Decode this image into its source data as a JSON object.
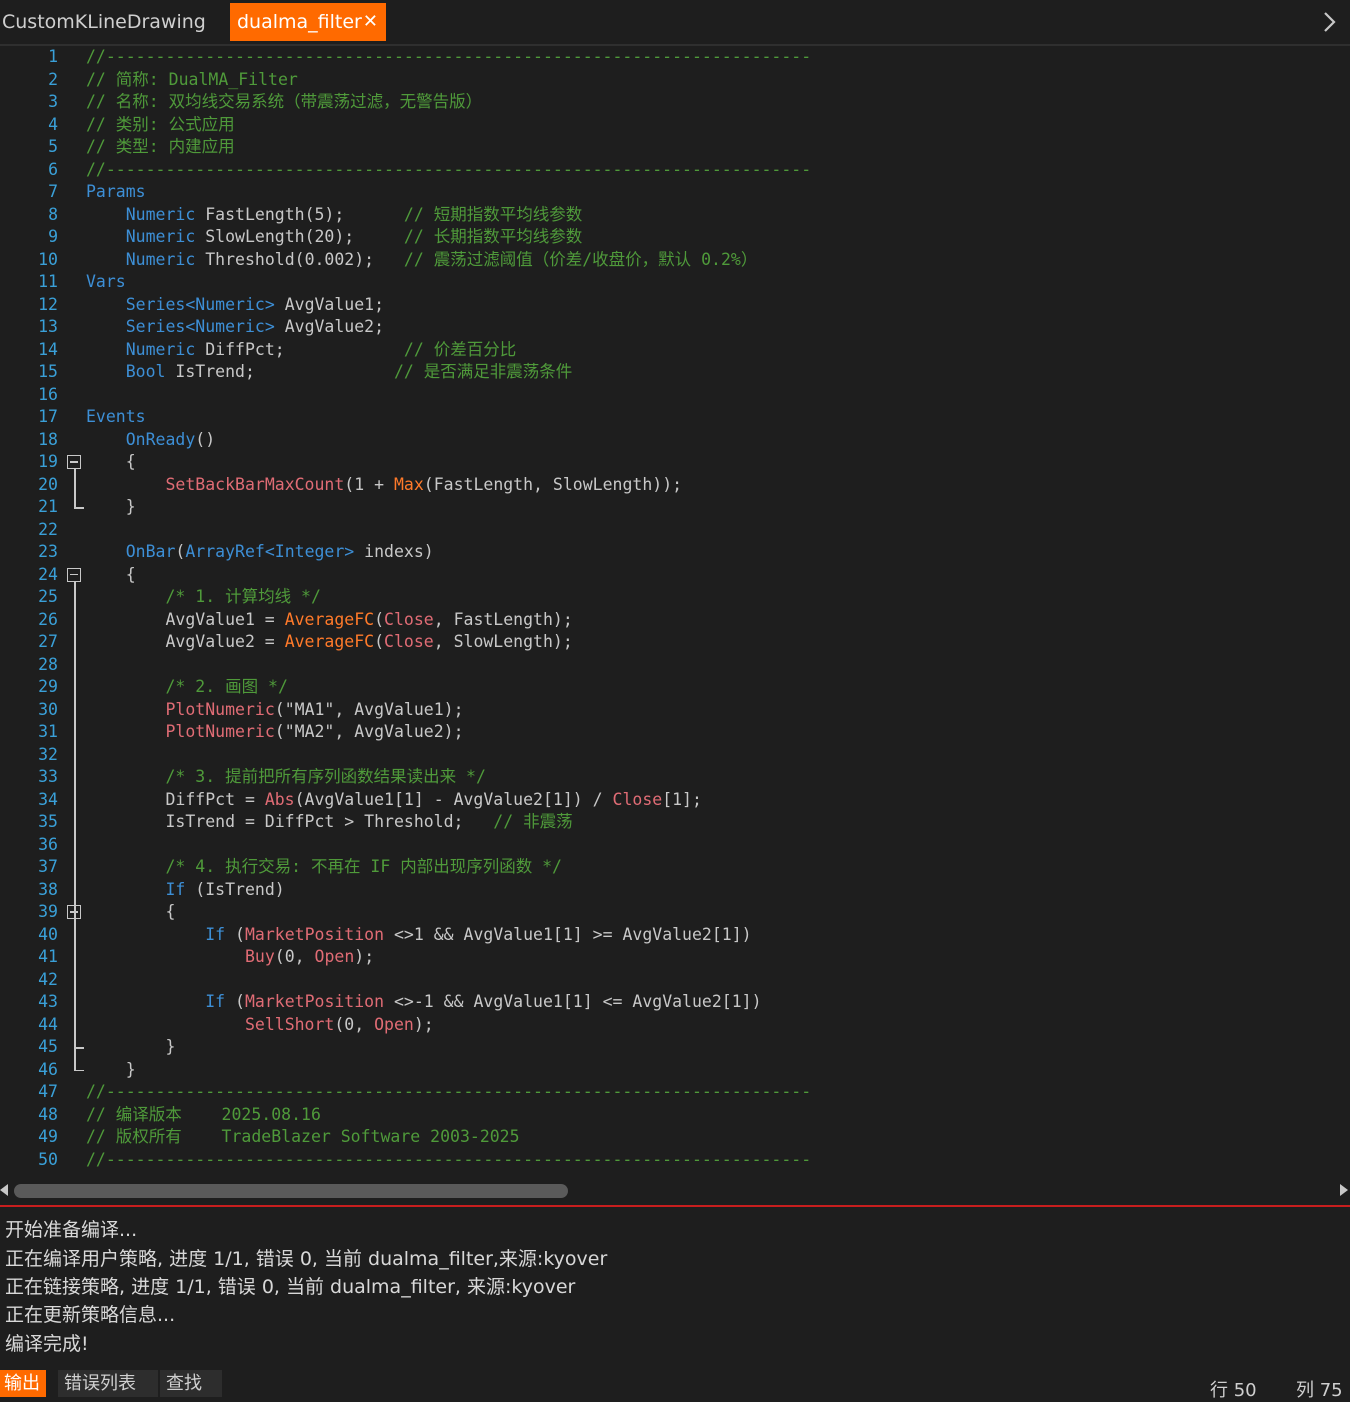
{
  "tabs": [
    {
      "label": "CustomKLineDrawing",
      "active": false
    },
    {
      "label": "dualma_filter",
      "active": true,
      "close": "✕"
    }
  ],
  "code": [
    {
      "n": "1",
      "parts": [
        [
          "c",
          "//-----------------------------------------------------------------------"
        ]
      ]
    },
    {
      "n": "2",
      "parts": [
        [
          "c",
          "// 简称: DualMA_Filter"
        ]
      ]
    },
    {
      "n": "3",
      "parts": [
        [
          "c",
          "// 名称: 双均线交易系统（带震荡过滤，无警告版）"
        ]
      ]
    },
    {
      "n": "4",
      "parts": [
        [
          "c",
          "// 类别: 公式应用"
        ]
      ]
    },
    {
      "n": "5",
      "parts": [
        [
          "c",
          "// 类型: 内建应用"
        ]
      ]
    },
    {
      "n": "6",
      "parts": [
        [
          "c",
          "//-----------------------------------------------------------------------"
        ]
      ]
    },
    {
      "n": "7",
      "parts": [
        [
          "k",
          "Params"
        ]
      ]
    },
    {
      "n": "8",
      "parts": [
        [
          "n",
          "    "
        ],
        [
          "k",
          "Numeric"
        ],
        [
          "n",
          " FastLength(5);      "
        ],
        [
          "c",
          "// 短期指数平均线参数"
        ]
      ]
    },
    {
      "n": "9",
      "parts": [
        [
          "n",
          "    "
        ],
        [
          "k",
          "Numeric"
        ],
        [
          "n",
          " SlowLength(20);     "
        ],
        [
          "c",
          "// 长期指数平均线参数"
        ]
      ]
    },
    {
      "n": "10",
      "parts": [
        [
          "n",
          "    "
        ],
        [
          "k",
          "Numeric"
        ],
        [
          "n",
          " Threshold(0.002);   "
        ],
        [
          "c",
          "// 震荡过滤阈值（价差/收盘价，默认 0.2%）"
        ]
      ]
    },
    {
      "n": "11",
      "parts": [
        [
          "k",
          "Vars"
        ]
      ]
    },
    {
      "n": "12",
      "parts": [
        [
          "n",
          "    "
        ],
        [
          "k",
          "Series<Numeric>"
        ],
        [
          "n",
          " AvgValue1;"
        ]
      ]
    },
    {
      "n": "13",
      "parts": [
        [
          "n",
          "    "
        ],
        [
          "k",
          "Series<Numeric>"
        ],
        [
          "n",
          " AvgValue2;"
        ]
      ]
    },
    {
      "n": "14",
      "parts": [
        [
          "n",
          "    "
        ],
        [
          "k",
          "Numeric"
        ],
        [
          "n",
          " DiffPct;            "
        ],
        [
          "c",
          "// 价差百分比"
        ]
      ]
    },
    {
      "n": "15",
      "parts": [
        [
          "n",
          "    "
        ],
        [
          "k",
          "Bool"
        ],
        [
          "n",
          " IsTrend;              "
        ],
        [
          "c",
          "// 是否满足非震荡条件"
        ]
      ]
    },
    {
      "n": "16",
      "parts": []
    },
    {
      "n": "17",
      "parts": [
        [
          "k",
          "Events"
        ]
      ]
    },
    {
      "n": "18",
      "parts": [
        [
          "n",
          "    "
        ],
        [
          "k",
          "OnReady"
        ],
        [
          "n",
          "()"
        ]
      ]
    },
    {
      "n": "19",
      "parts": [
        [
          "n",
          "    {"
        ]
      ]
    },
    {
      "n": "20",
      "parts": [
        [
          "n",
          "        "
        ],
        [
          "d",
          "SetBackBarMaxCount"
        ],
        [
          "n",
          "(1 + "
        ],
        [
          "f",
          "Max"
        ],
        [
          "n",
          "(FastLength, SlowLength));"
        ]
      ]
    },
    {
      "n": "21",
      "parts": [
        [
          "n",
          "    }"
        ]
      ]
    },
    {
      "n": "22",
      "parts": []
    },
    {
      "n": "23",
      "parts": [
        [
          "n",
          "    "
        ],
        [
          "k",
          "OnBar"
        ],
        [
          "n",
          "("
        ],
        [
          "k",
          "ArrayRef<Integer>"
        ],
        [
          "n",
          " indexs)"
        ]
      ]
    },
    {
      "n": "24",
      "parts": [
        [
          "n",
          "    {"
        ]
      ]
    },
    {
      "n": "25",
      "parts": [
        [
          "n",
          "        "
        ],
        [
          "c",
          "/* 1. 计算均线 */"
        ]
      ]
    },
    {
      "n": "26",
      "parts": [
        [
          "n",
          "        AvgValue1 = "
        ],
        [
          "f",
          "AverageFC"
        ],
        [
          "n",
          "("
        ],
        [
          "d",
          "Close"
        ],
        [
          "n",
          ", FastLength);"
        ]
      ]
    },
    {
      "n": "27",
      "parts": [
        [
          "n",
          "        AvgValue2 = "
        ],
        [
          "f",
          "AverageFC"
        ],
        [
          "n",
          "("
        ],
        [
          "d",
          "Close"
        ],
        [
          "n",
          ", SlowLength);"
        ]
      ]
    },
    {
      "n": "28",
      "parts": []
    },
    {
      "n": "29",
      "parts": [
        [
          "n",
          "        "
        ],
        [
          "c",
          "/* 2. 画图 */"
        ]
      ]
    },
    {
      "n": "30",
      "parts": [
        [
          "n",
          "        "
        ],
        [
          "d",
          "PlotNumeric"
        ],
        [
          "n",
          "(\"MA1\", AvgValue1);"
        ]
      ]
    },
    {
      "n": "31",
      "parts": [
        [
          "n",
          "        "
        ],
        [
          "d",
          "PlotNumeric"
        ],
        [
          "n",
          "(\"MA2\", AvgValue2);"
        ]
      ]
    },
    {
      "n": "32",
      "parts": []
    },
    {
      "n": "33",
      "parts": [
        [
          "n",
          "        "
        ],
        [
          "c",
          "/* 3. 提前把所有序列函数结果读出来 */"
        ]
      ]
    },
    {
      "n": "34",
      "parts": [
        [
          "n",
          "        DiffPct = "
        ],
        [
          "d",
          "Abs"
        ],
        [
          "n",
          "(AvgValue1[1] - AvgValue2[1]) / "
        ],
        [
          "d",
          "Close"
        ],
        [
          "n",
          "[1];"
        ]
      ]
    },
    {
      "n": "35",
      "parts": [
        [
          "n",
          "        IsTrend = DiffPct > Threshold;   "
        ],
        [
          "c",
          "// 非震荡"
        ]
      ]
    },
    {
      "n": "36",
      "parts": []
    },
    {
      "n": "37",
      "parts": [
        [
          "n",
          "        "
        ],
        [
          "c",
          "/* 4. 执行交易: 不再在 IF 内部出现序列函数 */"
        ]
      ]
    },
    {
      "n": "38",
      "parts": [
        [
          "n",
          "        "
        ],
        [
          "k",
          "If"
        ],
        [
          "n",
          " (IsTrend)"
        ]
      ]
    },
    {
      "n": "39",
      "parts": [
        [
          "n",
          "        {"
        ]
      ]
    },
    {
      "n": "40",
      "parts": [
        [
          "n",
          "            "
        ],
        [
          "k",
          "If"
        ],
        [
          "n",
          " ("
        ],
        [
          "d",
          "MarketPosition"
        ],
        [
          "n",
          " <>1 && AvgValue1[1] >= AvgValue2[1])"
        ]
      ]
    },
    {
      "n": "41",
      "parts": [
        [
          "n",
          "                "
        ],
        [
          "d",
          "Buy"
        ],
        [
          "n",
          "(0, "
        ],
        [
          "d",
          "Open"
        ],
        [
          "n",
          ");"
        ]
      ]
    },
    {
      "n": "42",
      "parts": []
    },
    {
      "n": "43",
      "parts": [
        [
          "n",
          "            "
        ],
        [
          "k",
          "If"
        ],
        [
          "n",
          " ("
        ],
        [
          "d",
          "MarketPosition"
        ],
        [
          "n",
          " <>-1 && AvgValue1[1] <= AvgValue2[1])"
        ]
      ]
    },
    {
      "n": "44",
      "parts": [
        [
          "n",
          "                "
        ],
        [
          "d",
          "SellShort"
        ],
        [
          "n",
          "(0, "
        ],
        [
          "d",
          "Open"
        ],
        [
          "n",
          ");"
        ]
      ]
    },
    {
      "n": "45",
      "parts": [
        [
          "n",
          "        }"
        ]
      ]
    },
    {
      "n": "46",
      "parts": [
        [
          "n",
          "    }"
        ]
      ]
    },
    {
      "n": "47",
      "parts": [
        [
          "c",
          "//-----------------------------------------------------------------------"
        ]
      ]
    },
    {
      "n": "48",
      "parts": [
        [
          "c",
          "// 编译版本    2025.08.16"
        ]
      ]
    },
    {
      "n": "49",
      "parts": [
        [
          "c",
          "// 版权所有    TradeBlazer Software 2003-2025"
        ]
      ]
    },
    {
      "n": "50",
      "parts": [
        [
          "c",
          "//-----------------------------------------------------------------------"
        ]
      ]
    }
  ],
  "output": {
    "lines": [
      "开始准备编译...",
      "正在编译用户策略, 进度 1/1, 错误 0, 当前 dualma_filter,来源:kyover",
      "正在链接策略, 进度 1/1, 错误 0, 当前 dualma_filter, 来源:kyover",
      "正在更新策略信息...",
      "编译完成!"
    ]
  },
  "bottom_tabs": [
    "输出",
    "错误列表",
    "查找"
  ],
  "status": {
    "row": "行 50",
    "col": "列 75"
  }
}
